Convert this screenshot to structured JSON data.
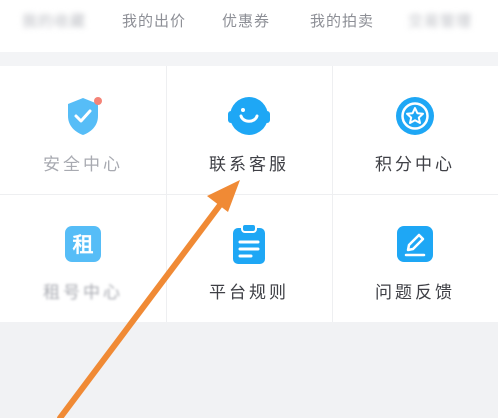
{
  "tabs": [
    {
      "label": "我的收藏",
      "blurred": true
    },
    {
      "label": "我的出价"
    },
    {
      "label": "优惠券"
    },
    {
      "label": "我的拍卖"
    },
    {
      "label": "交易管理",
      "blurred": true
    }
  ],
  "grid": {
    "items": [
      {
        "label": "安全中心",
        "icon": "shield-check-icon",
        "has_badge": true
      },
      {
        "label": "联系客服",
        "icon": "customer-service-headset-icon"
      },
      {
        "label": "积分中心",
        "icon": "star-badge-icon"
      },
      {
        "label": "租号中心",
        "icon": "rent-icon",
        "icon_text": "租"
      },
      {
        "label": "平台规则",
        "icon": "clipboard-rules-icon"
      },
      {
        "label": "问题反馈",
        "icon": "edit-feedback-icon"
      }
    ]
  },
  "colors": {
    "accent_blue": "#1ea7f5",
    "badge_red": "#f15a4a",
    "arrow_orange": "#f08a35"
  },
  "annotation": {
    "type": "arrow",
    "points_to": "联系客服"
  }
}
